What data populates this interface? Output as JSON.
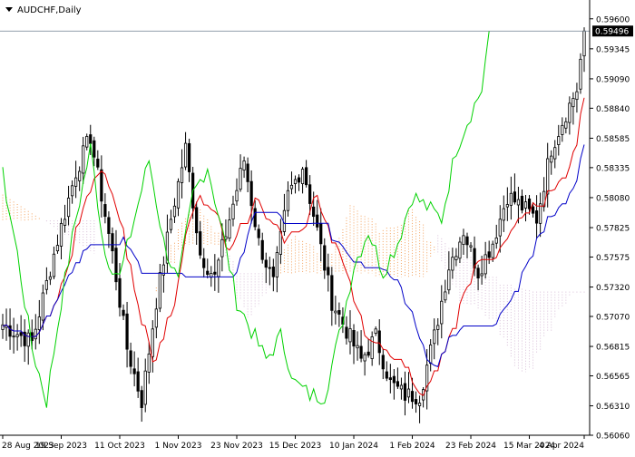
{
  "chart_data": {
    "type": "candlestick",
    "symbol_label": "AUDCHF,Daily",
    "current_price_label": "0.59496",
    "y_range": [
      0.5606,
      0.5976
    ],
    "y_ticks": [
      "0.59600",
      "0.59345",
      "0.59090",
      "0.58840",
      "0.58585",
      "0.58335",
      "0.58080",
      "0.57825",
      "0.57575",
      "0.57320",
      "0.57070",
      "0.56815",
      "0.56565",
      "0.56310",
      "0.56060"
    ],
    "x_tick_labels": [
      {
        "i": 0,
        "label": "28 Aug 2023"
      },
      {
        "i": 16,
        "label": "19 Sep 2023"
      },
      {
        "i": 32,
        "label": "11 Oct 2023"
      },
      {
        "i": 48,
        "label": "1 Nov 2023"
      },
      {
        "i": 64,
        "label": "23 Nov 2023"
      },
      {
        "i": 80,
        "label": "15 Dec 2023"
      },
      {
        "i": 96,
        "label": "10 Jan 2024"
      },
      {
        "i": 112,
        "label": "1 Feb 2024"
      },
      {
        "i": 128,
        "label": "23 Feb 2024"
      },
      {
        "i": 144,
        "label": "15 Mar 2024"
      },
      {
        "i": 159,
        "label": "4 Apr 2024"
      }
    ],
    "bar_count": 160,
    "close_anchors": [
      [
        0,
        0.57
      ],
      [
        8,
        0.5685
      ],
      [
        14,
        0.576
      ],
      [
        20,
        0.583
      ],
      [
        24,
        0.586
      ],
      [
        30,
        0.576
      ],
      [
        34,
        0.568
      ],
      [
        38,
        0.5635
      ],
      [
        42,
        0.572
      ],
      [
        46,
        0.579
      ],
      [
        50,
        0.585
      ],
      [
        54,
        0.576
      ],
      [
        58,
        0.574
      ],
      [
        62,
        0.579
      ],
      [
        66,
        0.584
      ],
      [
        70,
        0.577
      ],
      [
        74,
        0.5735
      ],
      [
        78,
        0.581
      ],
      [
        82,
        0.5835
      ],
      [
        86,
        0.578
      ],
      [
        90,
        0.572
      ],
      [
        94,
        0.5695
      ],
      [
        98,
        0.567
      ],
      [
        102,
        0.569
      ],
      [
        106,
        0.565
      ],
      [
        110,
        0.564
      ],
      [
        114,
        0.564
      ],
      [
        118,
        0.569
      ],
      [
        122,
        0.575
      ],
      [
        126,
        0.578
      ],
      [
        130,
        0.5745
      ],
      [
        134,
        0.577
      ],
      [
        138,
        0.581
      ],
      [
        142,
        0.58
      ],
      [
        146,
        0.579
      ],
      [
        150,
        0.585
      ],
      [
        154,
        0.588
      ],
      [
        157,
        0.59
      ],
      [
        159,
        0.595
      ]
    ],
    "colors": {
      "background": "#ffffff",
      "candles": "#000000",
      "tenkan_sen": "#e00000",
      "kijun_sen": "#0000c8",
      "chikou_span": "#00d200",
      "senkou_span_a": "#f4a460",
      "senkou_span_b": "#d8bfd8",
      "axis": "#000000",
      "price_line": "#708090"
    }
  }
}
